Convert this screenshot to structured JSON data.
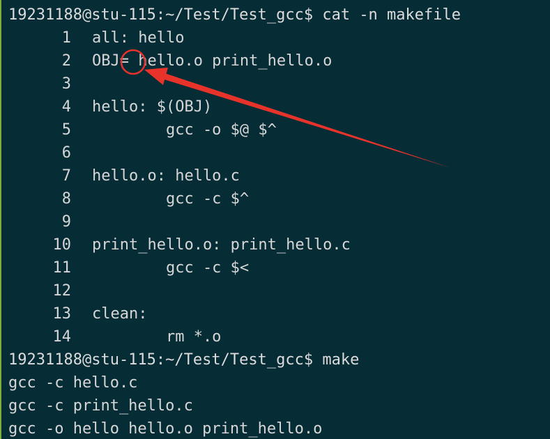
{
  "colors": {
    "background": "#062c36",
    "text": "#d6d6d6",
    "annotation": "#e8332b",
    "left_border": "#7fae3a"
  },
  "terminal": {
    "prompt_cat": "19231188@stu-115:~/Test/Test_gcc$ cat -n makefile",
    "file_lines": [
      {
        "num": "1",
        "text": "all: hello"
      },
      {
        "num": "2",
        "text": "OBJ= hello.o print_hello.o"
      },
      {
        "num": "3",
        "text": ""
      },
      {
        "num": "4",
        "text": "hello: $(OBJ)"
      },
      {
        "num": "5",
        "text": "        gcc -o $@ $^"
      },
      {
        "num": "6",
        "text": ""
      },
      {
        "num": "7",
        "text": "hello.o: hello.c"
      },
      {
        "num": "8",
        "text": "        gcc -c $^"
      },
      {
        "num": "9",
        "text": ""
      },
      {
        "num": "10",
        "text": "print_hello.o: print_hello.c"
      },
      {
        "num": "11",
        "text": "        gcc -c $<"
      },
      {
        "num": "12",
        "text": ""
      },
      {
        "num": "13",
        "text": "clean:"
      },
      {
        "num": "14",
        "text": "        rm *.o"
      }
    ],
    "prompt_make": "19231188@stu-115:~/Test/Test_gcc$ make",
    "make_output": [
      "gcc -c hello.c",
      "gcc -c print_hello.c",
      "gcc -o hello hello.o print_hello.o"
    ]
  },
  "annotation": {
    "shape": "circle-with-arrow",
    "target": "="
  }
}
